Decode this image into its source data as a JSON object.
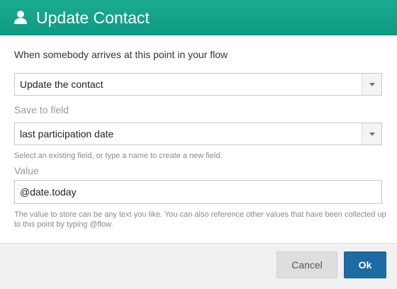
{
  "dialog": {
    "title": "Update Contact",
    "header_icon": "user-icon",
    "header_color": "#14a38b"
  },
  "action": {
    "prompt": "When somebody arrives at this point in your flow",
    "selected": "Update the contact"
  },
  "save_to_field": {
    "label": "Save to field",
    "selected": "last participation date",
    "help": "Select an existing field, or type a name to create a new field."
  },
  "value": {
    "label": "Value",
    "input_value": "@date.today",
    "help": "The value to store can be any text you like. You can also reference other values that have been collected up to this point by typing @flow."
  },
  "footer": {
    "cancel_label": "Cancel",
    "ok_label": "Ok",
    "ok_color": "#1e6aa5"
  }
}
